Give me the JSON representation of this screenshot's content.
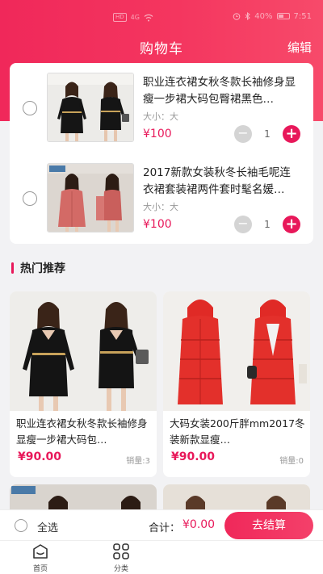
{
  "status_bar": {
    "left_chips": [
      "HD",
      "4G"
    ],
    "battery": "40%",
    "time": "7:51"
  },
  "header": {
    "title": "购物车",
    "edit_label": "编辑"
  },
  "cart": {
    "items": [
      {
        "title": "职业连衣裙女秋冬款长袖修身显瘦一步裙大码包臀裙黑色…",
        "spec": "大小：大",
        "price": "¥100",
        "quantity": "1"
      },
      {
        "title": "2017新款女装秋冬长袖毛呢连衣裙套装裙两件套时髦名媛…",
        "spec": "大小：大",
        "price": "¥100",
        "quantity": "1"
      }
    ]
  },
  "recommend": {
    "heading": "热门推荐",
    "items": [
      {
        "title": "职业连衣裙女秋冬款长袖修身显瘦一步裙大码包…",
        "price": "¥90.00",
        "sales": "销量:3"
      },
      {
        "title": "大码女装200斤胖mm2017冬装新款显瘦…",
        "price": "¥90.00",
        "sales": "销量:0"
      }
    ]
  },
  "checkout": {
    "select_all": "全选",
    "total_label": "合计：",
    "total_value": "¥0.00",
    "button_label": "去结算"
  },
  "tabs": [
    {
      "label": "首页",
      "icon": "home-icon"
    },
    {
      "label": "分类",
      "icon": "category-icon"
    }
  ],
  "colors": {
    "accent": "#e8185a",
    "header_gradient_start": "#f0285a",
    "header_gradient_end": "#f74a6a"
  }
}
